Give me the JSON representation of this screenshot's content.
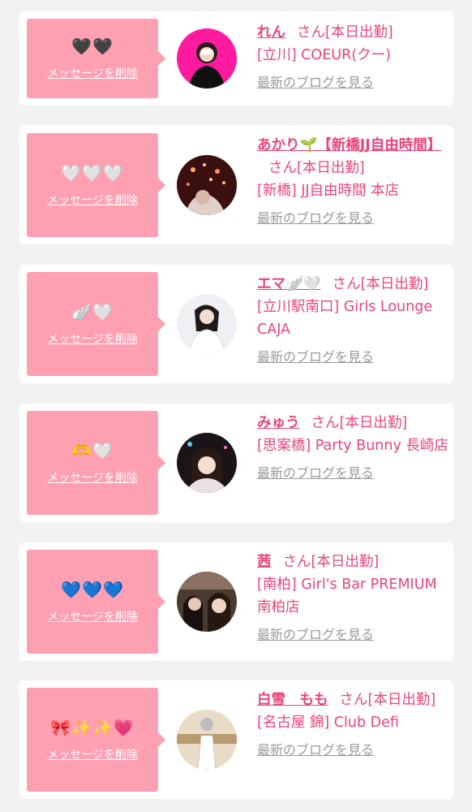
{
  "delete_label": "メッセージを削除",
  "blog_label": "最新のブログを見る",
  "cards": [
    {
      "emoji": "🖤🖤",
      "name": "れん",
      "suffix": "さん[本日出勤]",
      "shop": "[立川] COEUR(クー)"
    },
    {
      "emoji": "🤍🤍🤍",
      "name": "あかり🌱【新橋JJ自由時間】",
      "suffix": "さん[本日出勤]",
      "shop": "[新橋] JJ自由時間 本店"
    },
    {
      "emoji": "🪽🤍",
      "name": "エマ🪽🤍",
      "suffix": "さん[本日出勤]",
      "shop": "[立川駅南口] Girls Lounge CAJA"
    },
    {
      "emoji": "🫶🤍",
      "name": "みゅう",
      "suffix": "さん[本日出勤]",
      "shop": "[思案橋] Party Bunny 長崎店"
    },
    {
      "emoji": "💙💙💙",
      "name": "茜",
      "suffix": "さん[本日出勤]",
      "shop": "[南柏] Girl's Bar PREMIUM 南柏店"
    },
    {
      "emoji": "🎀✨✨💗",
      "name": "白雪　もも",
      "suffix": "さん[本日出勤]",
      "shop": "[名古屋 錦] Club Defi"
    }
  ]
}
